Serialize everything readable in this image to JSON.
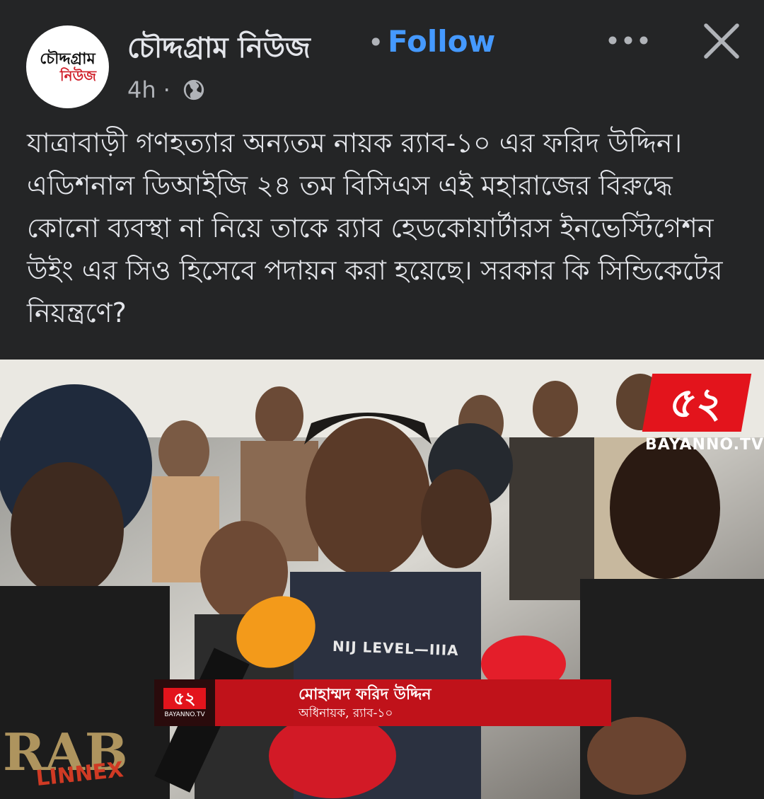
{
  "post": {
    "page_name": "চৌদ্দগ্রাম নিউজ",
    "separator": "•",
    "follow_label": "Follow",
    "time_ago": "4h",
    "meta_separator": "·",
    "privacy_icon": "globe-icon",
    "more_icon": "more-horizontal-icon",
    "close_icon": "close-icon",
    "avatar": {
      "logo_line1": "চৌদ্দগ্রাম",
      "logo_line2": "নিউজ"
    },
    "text": "যাত্রাবাড়ী গণহত্যার অন্যতম নায়ক র‍্যাব-১০ এর ফরিদ উদ্দিন। এডিশনাল ডিআইজি ২৪ তম বিসিএস এই মহারাজের বিরুদ্ধে কোনো ব্যবস্থা না নিয়ে তাকে র‍্যাব হেডকোয়ার্টারস ইনভেস্টিগেশন উইং এর সিও হিসেবে পদায়ন করা হয়েছে। সরকার কি সিন্ডিকেটের নিয়ন্ত্রণে?"
  },
  "photo": {
    "channel_mark": "৫২",
    "channel_name": "BAYANNO.TV",
    "lower_third": {
      "logo_mark": "৫২",
      "logo_text": "BAYANNO.TV",
      "name": "মোহাম্মদ ফরিদ উদ্দিন",
      "title": "অধিনায়ক, র‍্যাব-১০"
    },
    "vest_text": "NIJ LEVEL—IIIA"
  },
  "colors": {
    "background": "#242526",
    "text": "#e4e6eb",
    "secondary_text": "#b0b3b8",
    "follow": "#4599ff",
    "channel_red": "#e3141c"
  }
}
